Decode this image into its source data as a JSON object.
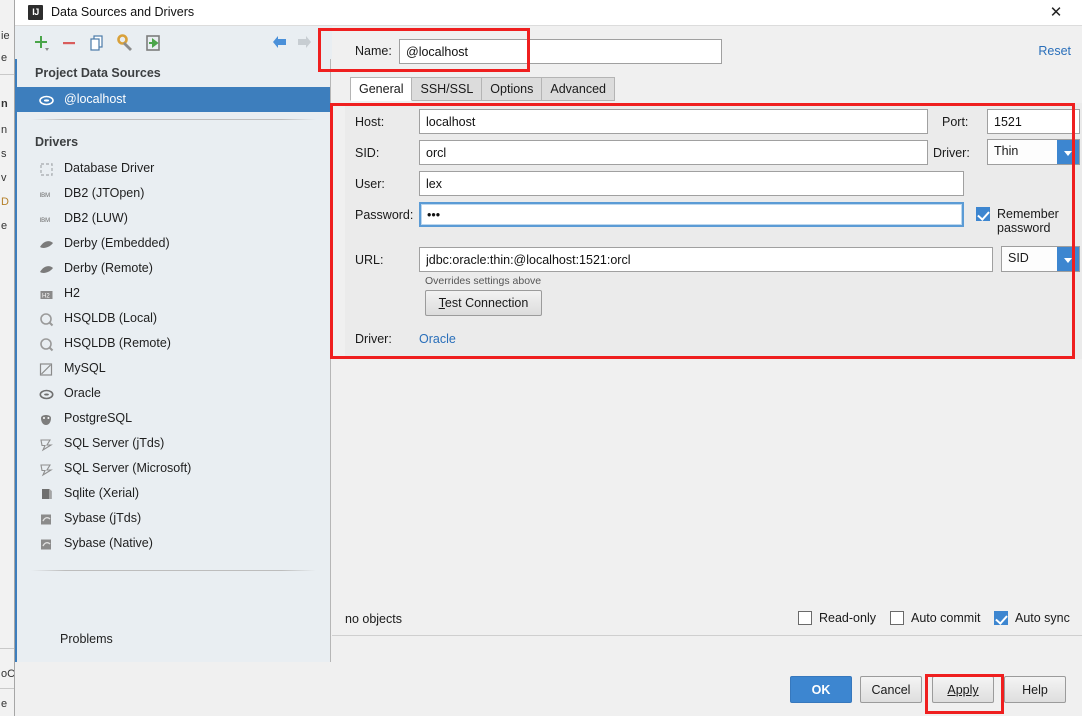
{
  "window": {
    "title": "Data Sources and Drivers",
    "app_icon": "IJ",
    "close_icon": "✕"
  },
  "toolbar": {
    "items": [
      {
        "name": "add-icon",
        "glyph": "+"
      },
      {
        "name": "remove-icon",
        "glyph": "−"
      },
      {
        "name": "copy-icon",
        "glyph": "❐"
      },
      {
        "name": "wrench-icon",
        "glyph": "⚒"
      },
      {
        "name": "import-icon",
        "glyph": "⇥"
      }
    ],
    "nav_back": "←",
    "nav_forward": "→"
  },
  "sidebar": {
    "project_group_label": "Project Data Sources",
    "data_sources": [
      {
        "label": "@localhost",
        "icon": "oracle-icon",
        "selected": true
      }
    ],
    "drivers_group_label": "Drivers",
    "drivers": [
      {
        "label": "Database Driver",
        "icon": "generic-driver-icon"
      },
      {
        "label": "DB2 (JTOpen)",
        "icon": "ibm-icon"
      },
      {
        "label": "DB2 (LUW)",
        "icon": "ibm-icon"
      },
      {
        "label": "Derby (Embedded)",
        "icon": "derby-icon"
      },
      {
        "label": "Derby (Remote)",
        "icon": "derby-icon"
      },
      {
        "label": "H2",
        "icon": "h2-icon"
      },
      {
        "label": "HSQLDB (Local)",
        "icon": "hsqldb-icon"
      },
      {
        "label": "HSQLDB (Remote)",
        "icon": "hsqldb-icon"
      },
      {
        "label": "MySQL",
        "icon": "mysql-icon"
      },
      {
        "label": "Oracle",
        "icon": "oracle-icon"
      },
      {
        "label": "PostgreSQL",
        "icon": "postgresql-icon"
      },
      {
        "label": "SQL Server (jTds)",
        "icon": "sqlserver-icon"
      },
      {
        "label": "SQL Server (Microsoft)",
        "icon": "sqlserver-icon"
      },
      {
        "label": "Sqlite (Xerial)",
        "icon": "sqlite-icon"
      },
      {
        "label": "Sybase (jTds)",
        "icon": "sybase-icon"
      },
      {
        "label": "Sybase (Native)",
        "icon": "sybase-icon"
      }
    ],
    "problems_label": "Problems"
  },
  "content": {
    "name_label": "Name:",
    "name_value": "@localhost",
    "reset_label": "Reset",
    "tabs": [
      {
        "label": "General",
        "active": true
      },
      {
        "label": "SSH/SSL",
        "active": false
      },
      {
        "label": "Options",
        "active": false
      },
      {
        "label": "Advanced",
        "active": false
      }
    ],
    "form": {
      "host_label": "Host:",
      "host_value": "localhost",
      "port_label": "Port:",
      "port_value": "1521",
      "sid_label": "SID:",
      "sid_value": "orcl",
      "driver_select_label": "Driver:",
      "driver_select_value": "Thin",
      "user_label": "User:",
      "user_value": "lex",
      "password_label": "Password:",
      "password_value": "•••",
      "remember_password_label": "Remember password",
      "remember_password_checked": true,
      "url_label": "URL:",
      "url_value": "jdbc:oracle:thin:@localhost:1521:orcl",
      "url_kind_value": "SID",
      "overrides_hint": "Overrides settings above",
      "test_connection_label": "Test Connection",
      "test_connection_mnemonic": "T",
      "driver_label": "Driver:",
      "driver_value": "Oracle"
    },
    "status": {
      "objects_text": "no objects",
      "read_only_label": "Read-only",
      "read_only_checked": false,
      "auto_commit_label": "Auto commit",
      "auto_commit_checked": false,
      "auto_sync_label": "Auto sync",
      "auto_sync_checked": true
    }
  },
  "footer": {
    "ok_label": "OK",
    "cancel_label": "Cancel",
    "apply_label": "Apply",
    "help_label": "Help"
  },
  "annotations": {
    "highlight_color": "#ef1f1f",
    "boxes": [
      "name-field",
      "general-form-panel",
      "apply-button"
    ]
  },
  "background_window": {
    "lines": [
      "ie",
      "e",
      "n",
      "n",
      "s",
      "v",
      "D",
      "e",
      "oC",
      "e"
    ]
  }
}
